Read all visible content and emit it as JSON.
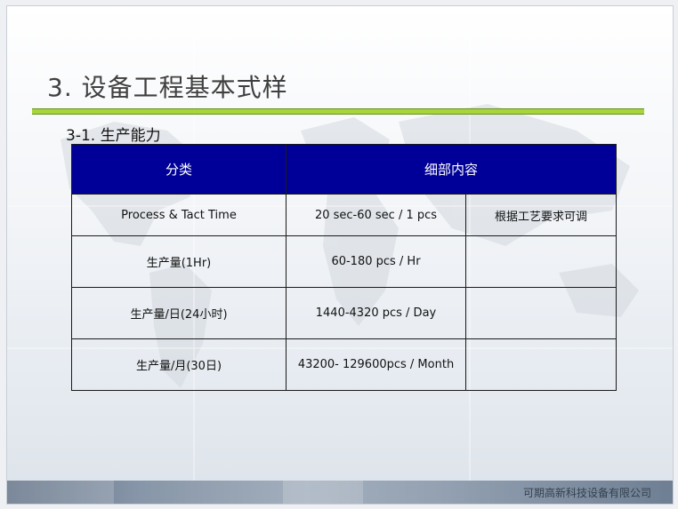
{
  "slide": {
    "title": "3.  设备工程基本式样",
    "subtitle": "3-1. 生产能力",
    "company": "可期高新科技设备有限公司"
  },
  "table": {
    "headers": [
      "分类",
      "细部内容"
    ],
    "rows": [
      {
        "item": "Process & Tact Time",
        "detail": "20 sec-60 sec  / 1 pcs",
        "note": "根据工艺要求可调"
      },
      {
        "item": "生产量(1Hr)",
        "detail": "60-180 pcs / Hr",
        "note": ""
      },
      {
        "item": "生产量/日(24小时)",
        "detail": "1440-4320 pcs / Day",
        "note": ""
      },
      {
        "item": "生产量/月(30日)",
        "detail": "43200- 129600pcs / Month",
        "note": ""
      }
    ]
  },
  "colors": {
    "header_bg": "#000099",
    "accent_bar": "#a6d63a"
  }
}
